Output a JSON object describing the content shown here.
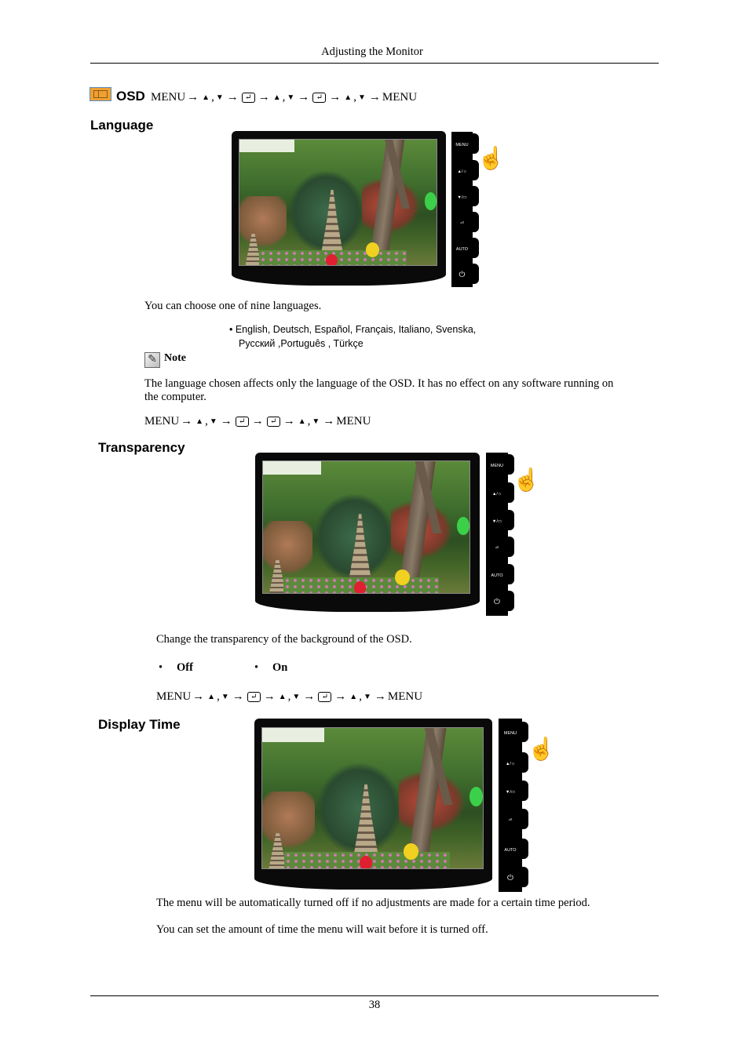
{
  "header": {
    "title": "Adjusting the Monitor"
  },
  "osd": {
    "icon": "osd-menu-icon",
    "label": "OSD",
    "sequence": [
      "MENU",
      "→",
      "▲",
      ",",
      "▼",
      "→",
      "enter",
      "→",
      "▲",
      ",",
      "▼",
      "→",
      "enter",
      "→",
      "▲",
      ",",
      "▼",
      "→",
      "MENU"
    ]
  },
  "sections": {
    "language": {
      "title": "Language",
      "description": "You can choose one of nine languages.",
      "languages_line1": "• English, Deutsch, Español, Français,  Italiano, Svenska,",
      "languages_line2": "Русский ,Português , Türkçe",
      "note_label": "Note",
      "note_text": "The language chosen affects only the language of the OSD. It has no effect on any software running on the computer.",
      "sequence": [
        "MENU",
        "→",
        "▲",
        ",",
        "▼",
        "→",
        "enter",
        "→",
        "enter",
        "→",
        "▲",
        ",",
        "▼",
        "→",
        "MENU"
      ]
    },
    "transparency": {
      "title": "Transparency",
      "description": "Change the transparency of the background of the OSD.",
      "options": [
        "Off",
        "On"
      ],
      "bullet": "•",
      "sequence": [
        "MENU",
        "→",
        "▲",
        ",",
        "▼",
        "→",
        "enter",
        "→",
        "▲",
        ",",
        "▼",
        "→",
        "enter",
        "→",
        "▲",
        ",",
        "▼",
        "→",
        "MENU"
      ]
    },
    "display_time": {
      "title": "Display Time",
      "description1": "The menu will be automatically turned off if no adjustments are made for a certain time period.",
      "description2": "You can set the amount of time the menu will wait before it is turned off."
    }
  },
  "monitor_panel": {
    "buttons": [
      "MENU",
      "▲/☼",
      "▼/▭",
      "⏎",
      "AUTO",
      "⏻"
    ]
  },
  "icons": {
    "enter": "↵",
    "hand": "☝",
    "note": "✎"
  },
  "footer": {
    "page_number": "38"
  }
}
